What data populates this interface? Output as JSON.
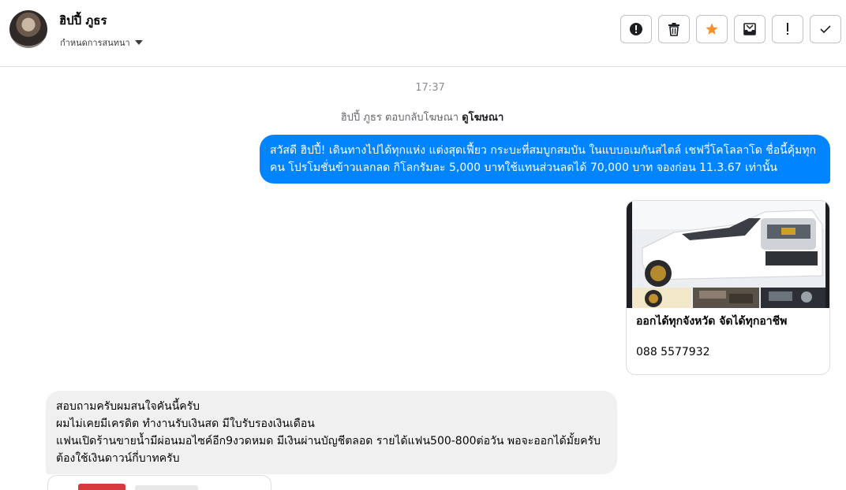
{
  "contact": {
    "name": "ฮิปปี้ ภูธร",
    "subtitle": "กำหนดการสนทนา"
  },
  "toolbar": {
    "buttons": [
      {
        "icon": "alert-circle-icon"
      },
      {
        "icon": "trash-icon"
      },
      {
        "icon": "star-icon"
      },
      {
        "icon": "mark-unread-icon"
      },
      {
        "icon": "exclamation-icon"
      },
      {
        "icon": "check-icon"
      }
    ],
    "colors": {
      "star": "#f5922c"
    }
  },
  "conversation": {
    "timestamp": "17:37",
    "reply_note": {
      "text": "ฮิปปี้ ภูธร ตอบกลับโฆษณา",
      "link": "ดูโฆษณา"
    },
    "outgoing_message": "สวัสดี ฮิปปี้! เดินทางไปได้ทุกแห่ง แต่งสุดเฟี้ยว กระบะที่สมบูกสมบัน ในแบบอเมกันสไตล์ เชฟวี่โคโลลาโด ชื่อนี้คุ้มทุกคน โปรโมชั่นข้าวแลกลด กิโลกรัมละ 5,000 บาทใช้แทนส่วนลดได้ 70,000 บาท จองก่อน 11.3.67 เท่านั้น",
    "ad_card": {
      "title": "ออกได้ทุกจังหวัด จัดได้ทุกอาชีพ",
      "phone": "088 5577932"
    },
    "incoming_message": [
      "สอบถามครับผมสนใจคันนี้ครับ",
      "ผมไม่เคยมีเครดิต ทำงานรับเงินสด มีใบรับรองเงินเดือน",
      "แฟนเปิดร้านขายน้ำมีผ่อนมอไซค์อีก9งวดหมด มีเงินผ่านบัญชีตลอด รายได้แฟน500-800ต่อวัน พอจะออกได้มั้ยครับ ต้องใช้เงินดาวน์กี่บาทครับ"
    ]
  },
  "colors": {
    "outgoing_bubble": "#0084ff",
    "incoming_bubble": "#f0f0f0"
  }
}
